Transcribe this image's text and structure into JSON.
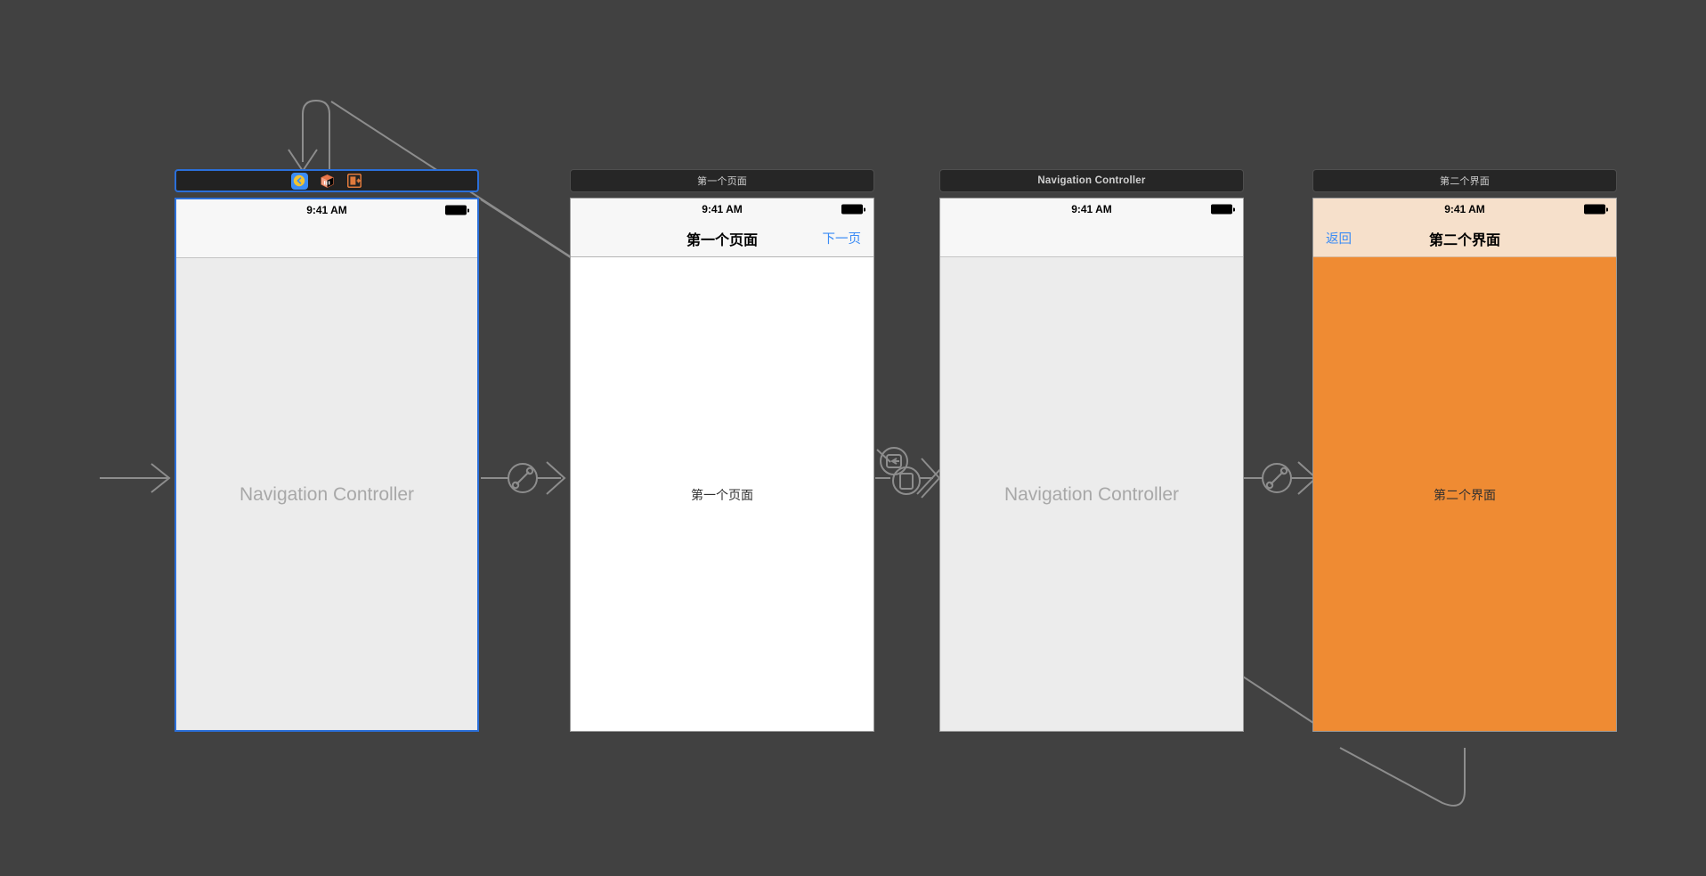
{
  "editor": {
    "name": "xcode-storyboard-canvas",
    "background": "#414141",
    "selection_color": "#2b6fd9"
  },
  "scenes": [
    {
      "id": "scene-nav-controller-1",
      "title": "Navigation Controller",
      "title_visible": false,
      "selected": true,
      "icons": [
        {
          "name": "navigation-controller-icon",
          "label": "Navigation Controller"
        },
        {
          "name": "first-responder-icon",
          "label": "First Responder"
        },
        {
          "name": "exit-icon",
          "label": "Exit"
        }
      ],
      "status_bar": {
        "time": "9:41 AM",
        "battery": "full"
      },
      "nav_bar": {
        "left": "",
        "title": "",
        "right": "",
        "background": "#f7f7f7"
      },
      "body": {
        "text": "Navigation Controller",
        "style": "placeholder",
        "background": "#ececec"
      }
    },
    {
      "id": "scene-first-page",
      "title": "第一个页面",
      "title_visible": true,
      "selected": false,
      "status_bar": {
        "time": "9:41 AM",
        "battery": "full"
      },
      "nav_bar": {
        "left": "",
        "title": "第一个页面",
        "right": "下一页",
        "background": "#f7f7f7"
      },
      "body": {
        "text": "第一个页面",
        "style": "label",
        "background": "#ffffff"
      }
    },
    {
      "id": "scene-nav-controller-2",
      "title": "Navigation Controller",
      "title_visible": true,
      "selected": false,
      "status_bar": {
        "time": "9:41 AM",
        "battery": "full"
      },
      "nav_bar": {
        "left": "",
        "title": "",
        "right": "",
        "background": "#f7f7f7"
      },
      "body": {
        "text": "Navigation Controller",
        "style": "placeholder",
        "background": "#ececec"
      }
    },
    {
      "id": "scene-second-page",
      "title": "第二个界面",
      "title_visible": true,
      "selected": false,
      "status_bar": {
        "time": "9:41 AM",
        "battery": "full"
      },
      "nav_bar": {
        "left": "返回",
        "title": "第二个界面",
        "right": "",
        "background": "#f6e0cb"
      },
      "body": {
        "text": "第二个界面",
        "style": "label",
        "background": "#ef8b33"
      }
    }
  ],
  "connections": [
    {
      "name": "initial-view-controller-arrow",
      "type": "entry-point",
      "label": ""
    },
    {
      "name": "relationship-segue-root-1",
      "type": "relationship",
      "badge": "root-view-controller"
    },
    {
      "name": "segue-show-second",
      "type": "show",
      "badge": "show-segue"
    },
    {
      "name": "segue-present-modally",
      "type": "present",
      "badge": "present-segue"
    },
    {
      "name": "relationship-segue-root-2",
      "type": "relationship",
      "badge": "root-view-controller"
    },
    {
      "name": "dangling-connection-top",
      "type": "outlet",
      "label": ""
    },
    {
      "name": "dangling-connection-bottom",
      "type": "outlet",
      "label": ""
    }
  ],
  "colors": {
    "canvas": "#414141",
    "accent_orange": "#ef8b33",
    "nav_tint": "#f6e0cb",
    "link_blue": "#3b8cf5",
    "selection": "#2b6fd9"
  }
}
